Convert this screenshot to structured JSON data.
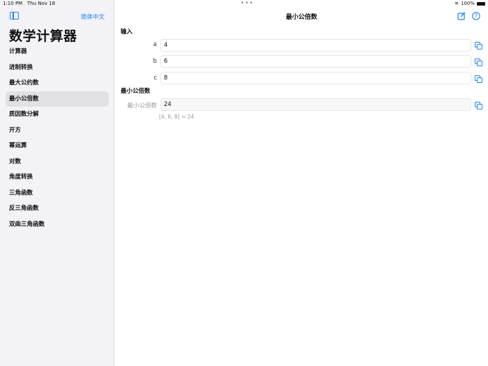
{
  "status": {
    "time": "1:10 PM",
    "date": "Thu Nov 18",
    "battery": "100%"
  },
  "sidebar": {
    "language": "简体中文",
    "title": "数学计算器",
    "items": [
      {
        "label": "计算器"
      },
      {
        "label": "进制转换"
      },
      {
        "label": "最大公约数"
      },
      {
        "label": "最小公倍数",
        "selected": true
      },
      {
        "label": "质因数分解"
      },
      {
        "label": "开方"
      },
      {
        "label": "幂运算"
      },
      {
        "label": "对数"
      },
      {
        "label": "角度转换"
      },
      {
        "label": "三角函数"
      },
      {
        "label": "反三角函数"
      },
      {
        "label": "双曲三角函数"
      }
    ]
  },
  "main": {
    "title": "最小公倍数",
    "input_section": "输入",
    "inputs": [
      {
        "label": "a",
        "value": "4"
      },
      {
        "label": "b",
        "value": "6"
      },
      {
        "label": "c",
        "value": "8"
      }
    ],
    "result_section": "最小公倍数",
    "result": {
      "label": "最小公倍数",
      "value": "24"
    },
    "note": "[4, 6, 8] = 24"
  },
  "icons": {
    "sidebar_toggle": "sidebar-icon",
    "edit": "compose-icon",
    "help": "question-icon",
    "copy": "copy-icon"
  },
  "colors": {
    "accent": "#1a82fb"
  }
}
